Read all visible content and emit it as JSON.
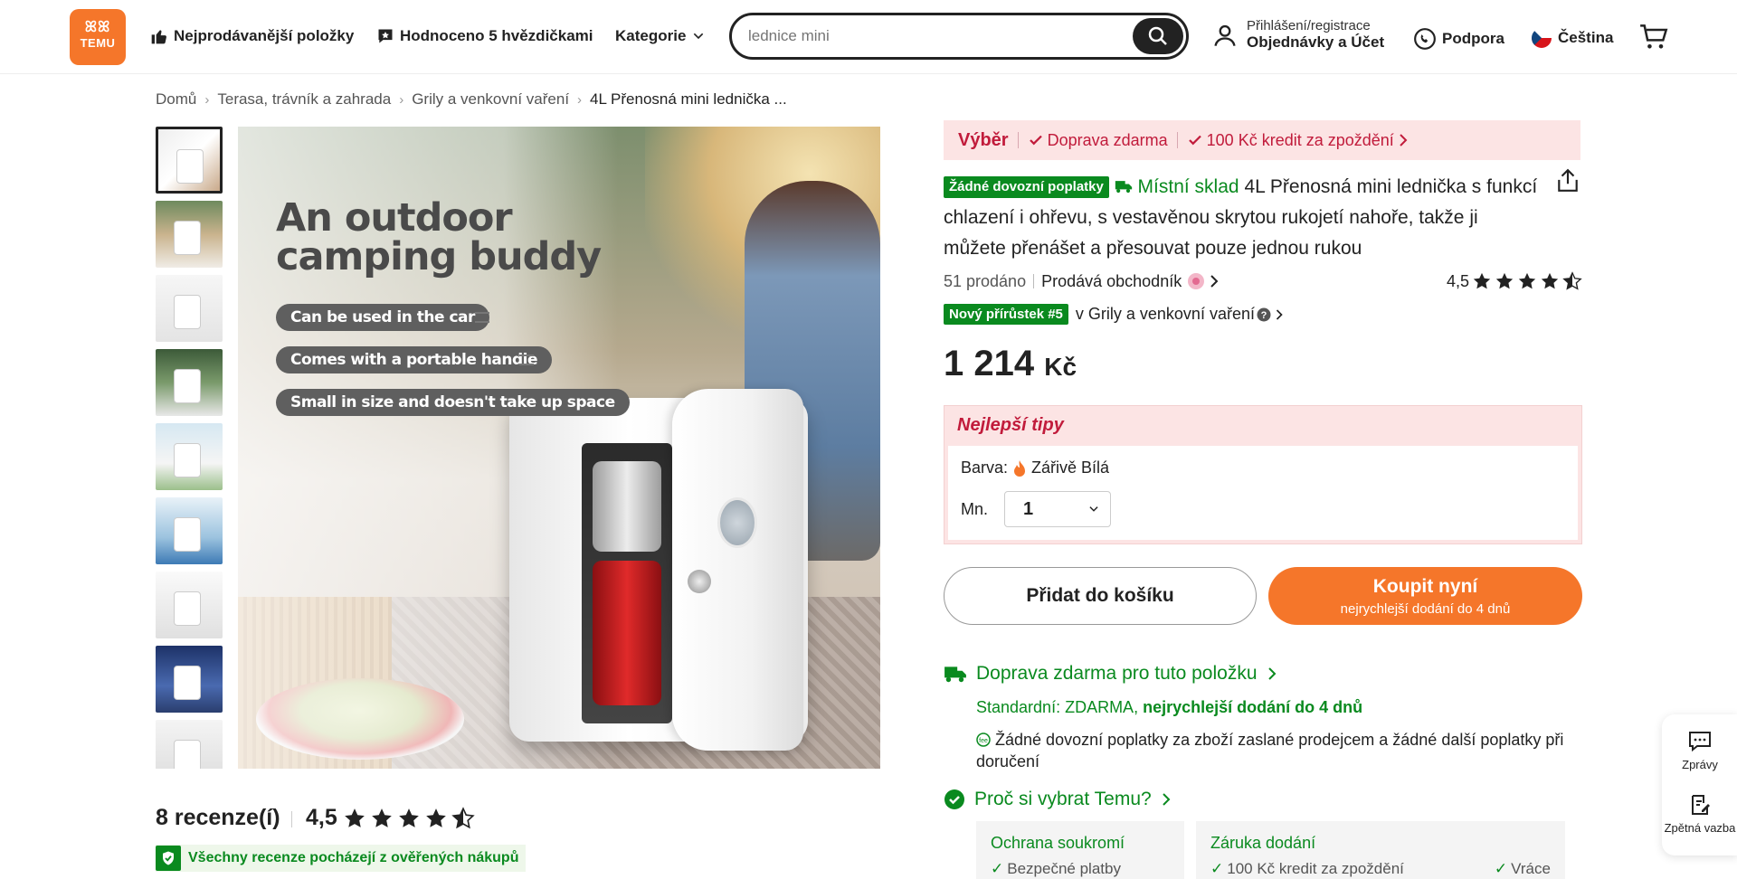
{
  "header": {
    "logo_top": "ꕤꕤ",
    "logo_text": "TEMU",
    "nav_bestsellers": "Nejprodávanější položky",
    "nav_five_star": "Hodnoceno 5 hvězdičkami",
    "nav_categories": "Kategorie",
    "search_placeholder": "lednice mini",
    "account_line1": "Přihlášení/registrace",
    "account_line2": "Objednávky a Účet",
    "support": "Podpora",
    "language": "Čeština"
  },
  "breadcrumb": [
    "Domů",
    "Terasa, trávník a zahrada",
    "Grily a venkovní vaření",
    "4L Přenosná mini lednička ..."
  ],
  "image": {
    "headline_1": "An outdoor",
    "headline_2": "camping buddy",
    "pill_1": "Can be used in the car",
    "pill_2": "Comes with a portable handle",
    "pill_3": "Small in size and doesn't take up space"
  },
  "reviews": {
    "count": "8 recenze(í)",
    "rating": "4,5",
    "verified": "Všechny recenze pocházejí z ověřených nákupů"
  },
  "banner": {
    "selection": "Výběr",
    "free_shipping": "Doprava zdarma",
    "credit": "100 Kč kredit za zpoždění"
  },
  "product": {
    "no_import_badge": "Žádné dovozní poplatky",
    "local_warehouse": "Místní sklad",
    "title": "4L Přenosná mini lednička s funkcí chlazení i ohřevu, s vestavěnou skrytou rukojetí nahoře, takže ji můžete přenášet a přesouvat pouze jednou rukou",
    "sold": "51 prodáno",
    "seller": "Prodává obchodník",
    "rating": "4,5",
    "new_badge": "Nový přírůstek #5",
    "new_category": "v Grily a venkovní vaření",
    "price": "1 214",
    "currency": "Kč"
  },
  "tips": {
    "title": "Nejlepší tipy",
    "color_label": "Barva:",
    "color_value": "Zářivě Bílá",
    "qty_label": "Mn.",
    "qty_value": "1"
  },
  "buttons": {
    "add_to_cart": "Přidat do košíku",
    "buy_now": "Koupit nyní",
    "buy_now_sub": "nejrychlejší dodání do 4 dnů"
  },
  "shipping": {
    "headline": "Doprava zdarma pro tuto položku",
    "standard_prefix": "Standardní: ZDARMA,",
    "standard_fast": "nejrychlejší dodání do 4 dnů",
    "note": "Žádné dovozní poplatky za zboží zaslané prodejcem a žádné další poplatky při doručení"
  },
  "why": {
    "headline": "Proč si vybrat Temu?",
    "card1_title": "Ochrana soukromí",
    "card1_line": "Bezpečné platby",
    "card2_title": "Záruka dodání",
    "card2_line": "100 Kč kredit za zpoždění",
    "card3_line": "Vráce"
  },
  "side_widget": {
    "messages": "Zprávy",
    "feedback": "Zpětná vazba"
  },
  "colors": {
    "brand_orange": "#f5762a",
    "accent_red": "#c11b3b",
    "accent_green": "#0a8a1f"
  }
}
